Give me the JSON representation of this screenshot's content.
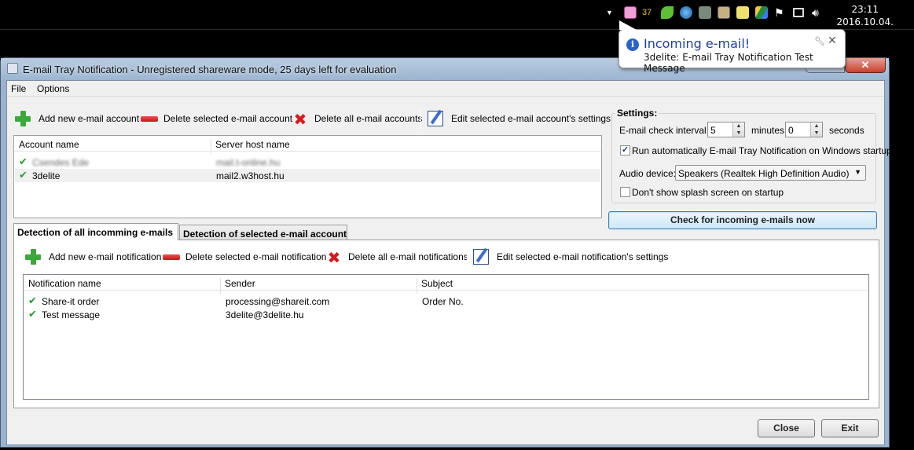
{
  "taskbar": {
    "mail_count": "37",
    "clock_time": "23:11",
    "clock_date": "2016.10.04."
  },
  "balloon": {
    "title": "Incoming e-mail!",
    "text": "3delite: E-mail Tray Notification Test Message"
  },
  "window": {
    "title": "E-mail Tray Notification - Unregistered shareware mode, 25 days left for evaluation",
    "menu": [
      "File",
      "Options"
    ]
  },
  "account_toolbar": {
    "add": "Add new e-mail account",
    "delete": "Delete selected e-mail account",
    "delete_all": "Delete all e-mail accounts",
    "edit": "Edit selected e-mail account's settings"
  },
  "accounts": {
    "columns": [
      "Account name",
      "Server host name"
    ],
    "rows": [
      {
        "name": "Csendes Ede",
        "server": "mail.t-online.hu",
        "blurred": true
      },
      {
        "name": "3delite",
        "server": "mail2.w3host.hu",
        "blurred": false
      }
    ]
  },
  "settings": {
    "title": "Settings:",
    "interval_label": "E-mail check interval:",
    "minutes_value": "5",
    "minutes_label": "minutes",
    "seconds_value": "0",
    "seconds_label": "seconds",
    "startup_label": "Run automatically E-mail Tray Notification on Windows startup",
    "startup_checked": true,
    "audio_label": "Audio device:",
    "audio_value": "Speakers (Realtek High Definition Audio)",
    "splash_label": "Don't show splash screen on startup",
    "splash_checked": false
  },
  "check_button": "Check for incoming e-mails now",
  "tabs": [
    "Detection of all incomming e-mails",
    "Detection of selected e-mail account"
  ],
  "notif_toolbar": {
    "add": "Add new e-mail notification",
    "delete": "Delete selected e-mail notification",
    "delete_all": "Delete all e-mail notifications",
    "edit": "Edit selected e-mail notification's settings"
  },
  "notifications": {
    "columns": [
      "Notification name",
      "Sender",
      "Subject"
    ],
    "rows": [
      {
        "name": "Share-it order",
        "sender": "processing@shareit.com",
        "subject": "Order No."
      },
      {
        "name": "Test message",
        "sender": "3delite@3delite.hu",
        "subject": ""
      }
    ]
  },
  "footer": {
    "close": "Close",
    "exit": "Exit"
  }
}
